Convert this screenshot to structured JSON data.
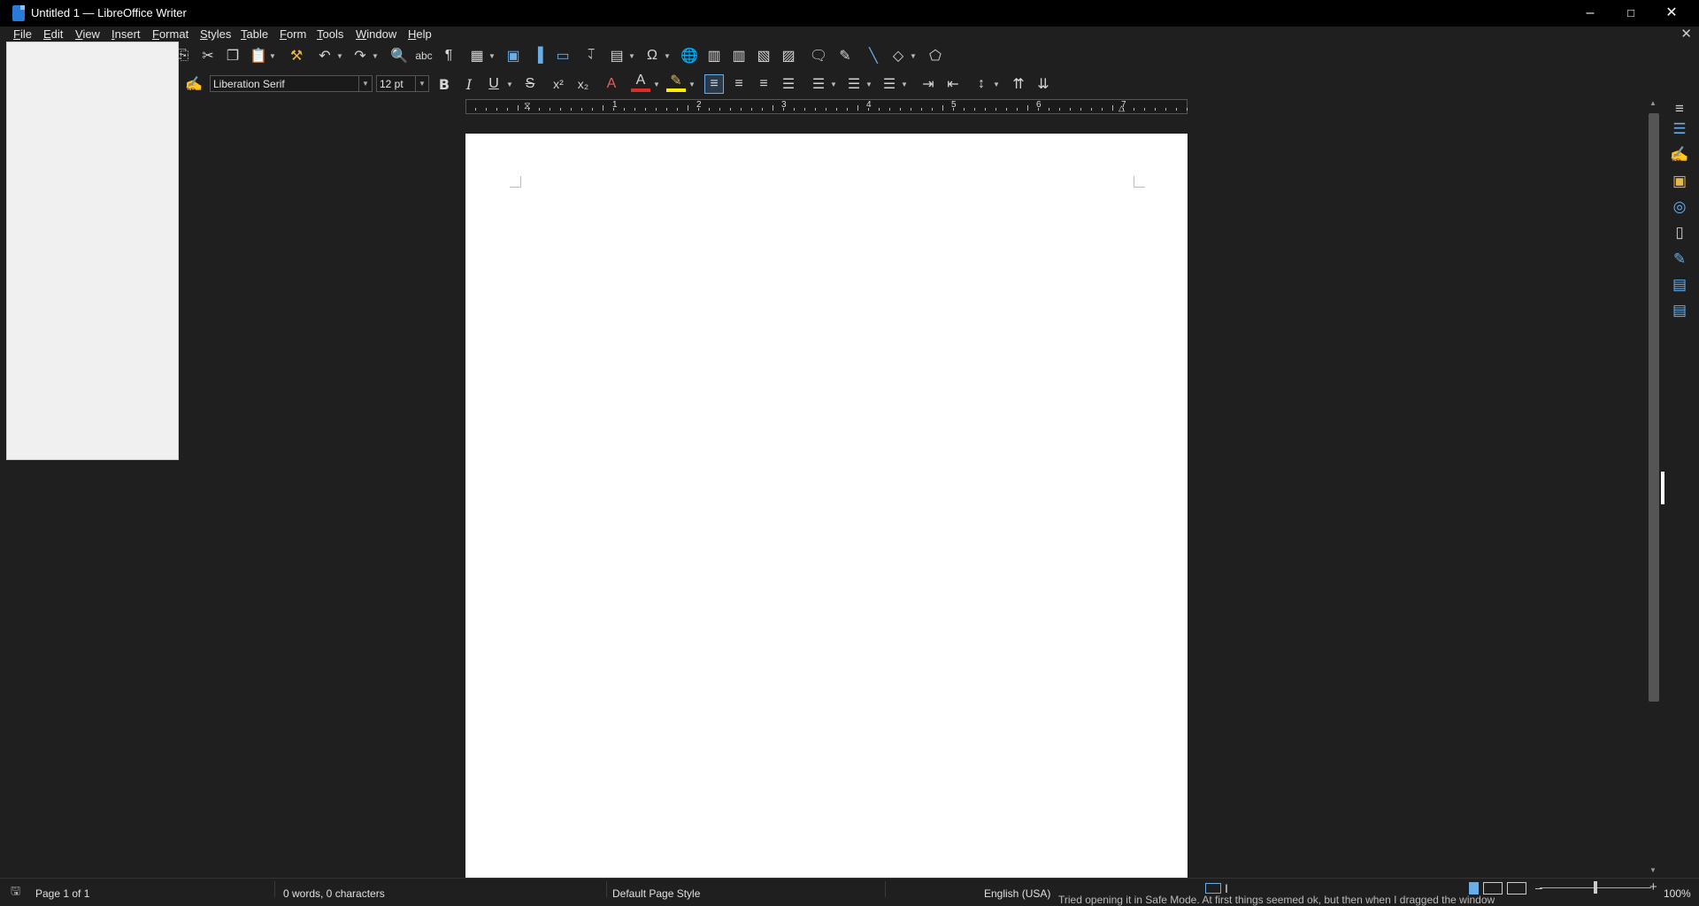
{
  "window": {
    "title": "Untitled 1 — LibreOffice Writer",
    "icon": "writer-document-icon"
  },
  "menu": [
    "File",
    "Edit",
    "View",
    "Insert",
    "Format",
    "Styles",
    "Table",
    "Form",
    "Tools",
    "Window",
    "Help"
  ],
  "formatting": {
    "font_name": "Liberation Serif",
    "font_size": "12 pt"
  },
  "ruler": {
    "numbers": [
      "1",
      "2",
      "3",
      "4",
      "5",
      "6",
      "7"
    ]
  },
  "status": {
    "page": "Page 1 of 1",
    "words": "0 words, 0 characters",
    "page_style": "Default Page Style",
    "language": "English (USA)",
    "zoom": "100%",
    "overflow_text": "Tried opening it in Safe Mode. At first things seemed ok, but then when I dragged the window"
  },
  "colors": {
    "font_color": "#e02b2b",
    "highlight_color": "#ffee00",
    "accent": "#2a7bd8"
  }
}
